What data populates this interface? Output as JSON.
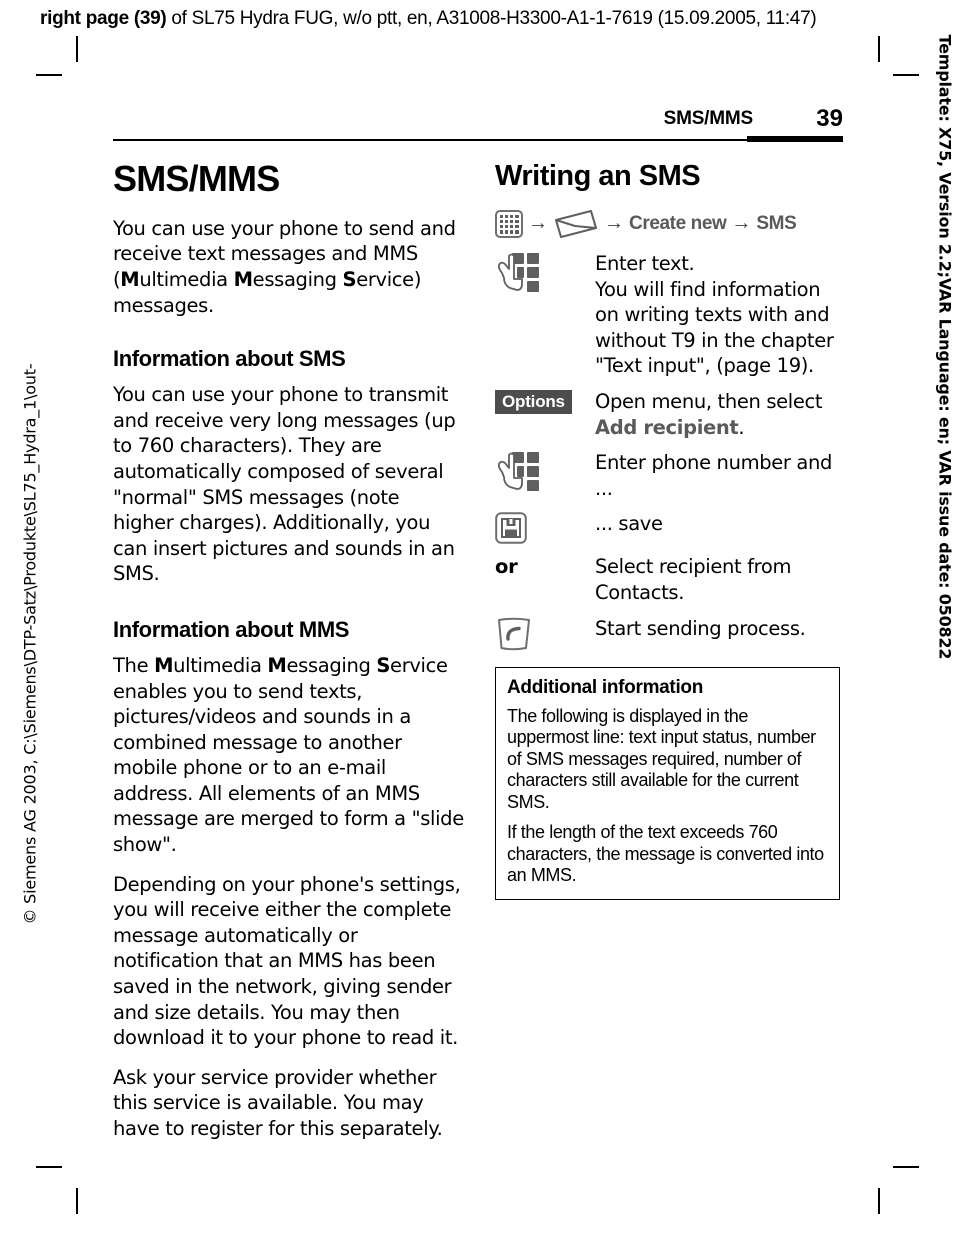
{
  "job_ticket": {
    "bold_prefix": "right page (39)",
    "rest": " of SL75 Hydra FUG, w/o ptt, en, A31008-H3300-A1-1-7619 (15.09.2005, 11:47)"
  },
  "side_notes": {
    "left": "© Siemens AG 2003, C:\\Siemens\\DTP-Satz\\Produkte\\SL75_Hydra_1\\out-",
    "right": "Template: X75, Version 2.2;VAR Language: en; VAR issue date: 050822"
  },
  "running_head": {
    "title": "SMS/MMS",
    "page_number": "39"
  },
  "left_column": {
    "chapter_title": "SMS/MMS",
    "intro": {
      "part1": "You can use your phone to send and receive text messages and MMS (",
      "b1": "M",
      "part2": "ultimedia ",
      "b2": "M",
      "part3": "essaging ",
      "b3": "S",
      "part4": "ervice) messages."
    },
    "sms_heading": "Information about SMS",
    "sms_paragraph": "You can use your phone to transmit and receive very long messages (up to 760 characters). They are automatically composed of several \"normal\" SMS messages (note higher charges). Additionally, you can insert pictures and sounds in an SMS.",
    "mms_heading": "Information about MMS",
    "mms_paragraph_1": {
      "part1": "The ",
      "b1": "M",
      "part2": "ultimedia ",
      "b2": "M",
      "part3": "essaging ",
      "b3": "S",
      "part4": "ervice enables you to send texts, pictures/videos and sounds in a combined message to another mobile phone or to an e-mail address. All elements of an MMS message are merged to form a \"slide show\"."
    },
    "mms_paragraph_2": "Depending on your phone's settings, you will receive either the complete message automatically or notification that an MMS has been saved in the network, giving sender and size details. You may then download it to your phone to read it.",
    "mms_paragraph_3": "Ask your service provider whether this service is available. You may have to register for this separately."
  },
  "right_column": {
    "heading": "Writing an SMS",
    "breadcrumb": {
      "menu_icon": "menu-grid-icon",
      "envelope_icon": "envelope-icon",
      "arrow": "→",
      "item_create_new": "Create new",
      "item_sms": "SMS"
    },
    "steps": [
      {
        "icon": "keypad-hand-icon",
        "text": "Enter text.\nYou will find information on writing texts with and without T9 in the chapter \"Text input\", (page 19)."
      },
      {
        "icon": "options-softkey-badge",
        "softkey_label": "Options",
        "text_before": "Open menu, then select ",
        "text_bold": "Add recipient",
        "text_after": "."
      },
      {
        "icon": "keypad-hand-icon",
        "text": "Enter phone number and ..."
      },
      {
        "icon": "save-floppy-icon",
        "text": "... save"
      },
      {
        "icon": "or-label",
        "or_label": "or",
        "text": "Select recipient from Contacts."
      },
      {
        "icon": "call-key-icon",
        "text": "Start sending process."
      }
    ],
    "info_box": {
      "heading": "Additional information",
      "paragraph_1": "The following is displayed in the uppermost line: text input status, number of SMS messages required, number of characters still available for the current SMS.",
      "paragraph_2": "If the length of the text exceeds 760 characters, the message is converted into an MMS."
    }
  },
  "colors": {
    "icon_gray": "#5f5f5f",
    "breadcrumb_gray": "#5a5a5a",
    "softkey_bg": "#4d4d4d",
    "text_black": "#000000"
  }
}
